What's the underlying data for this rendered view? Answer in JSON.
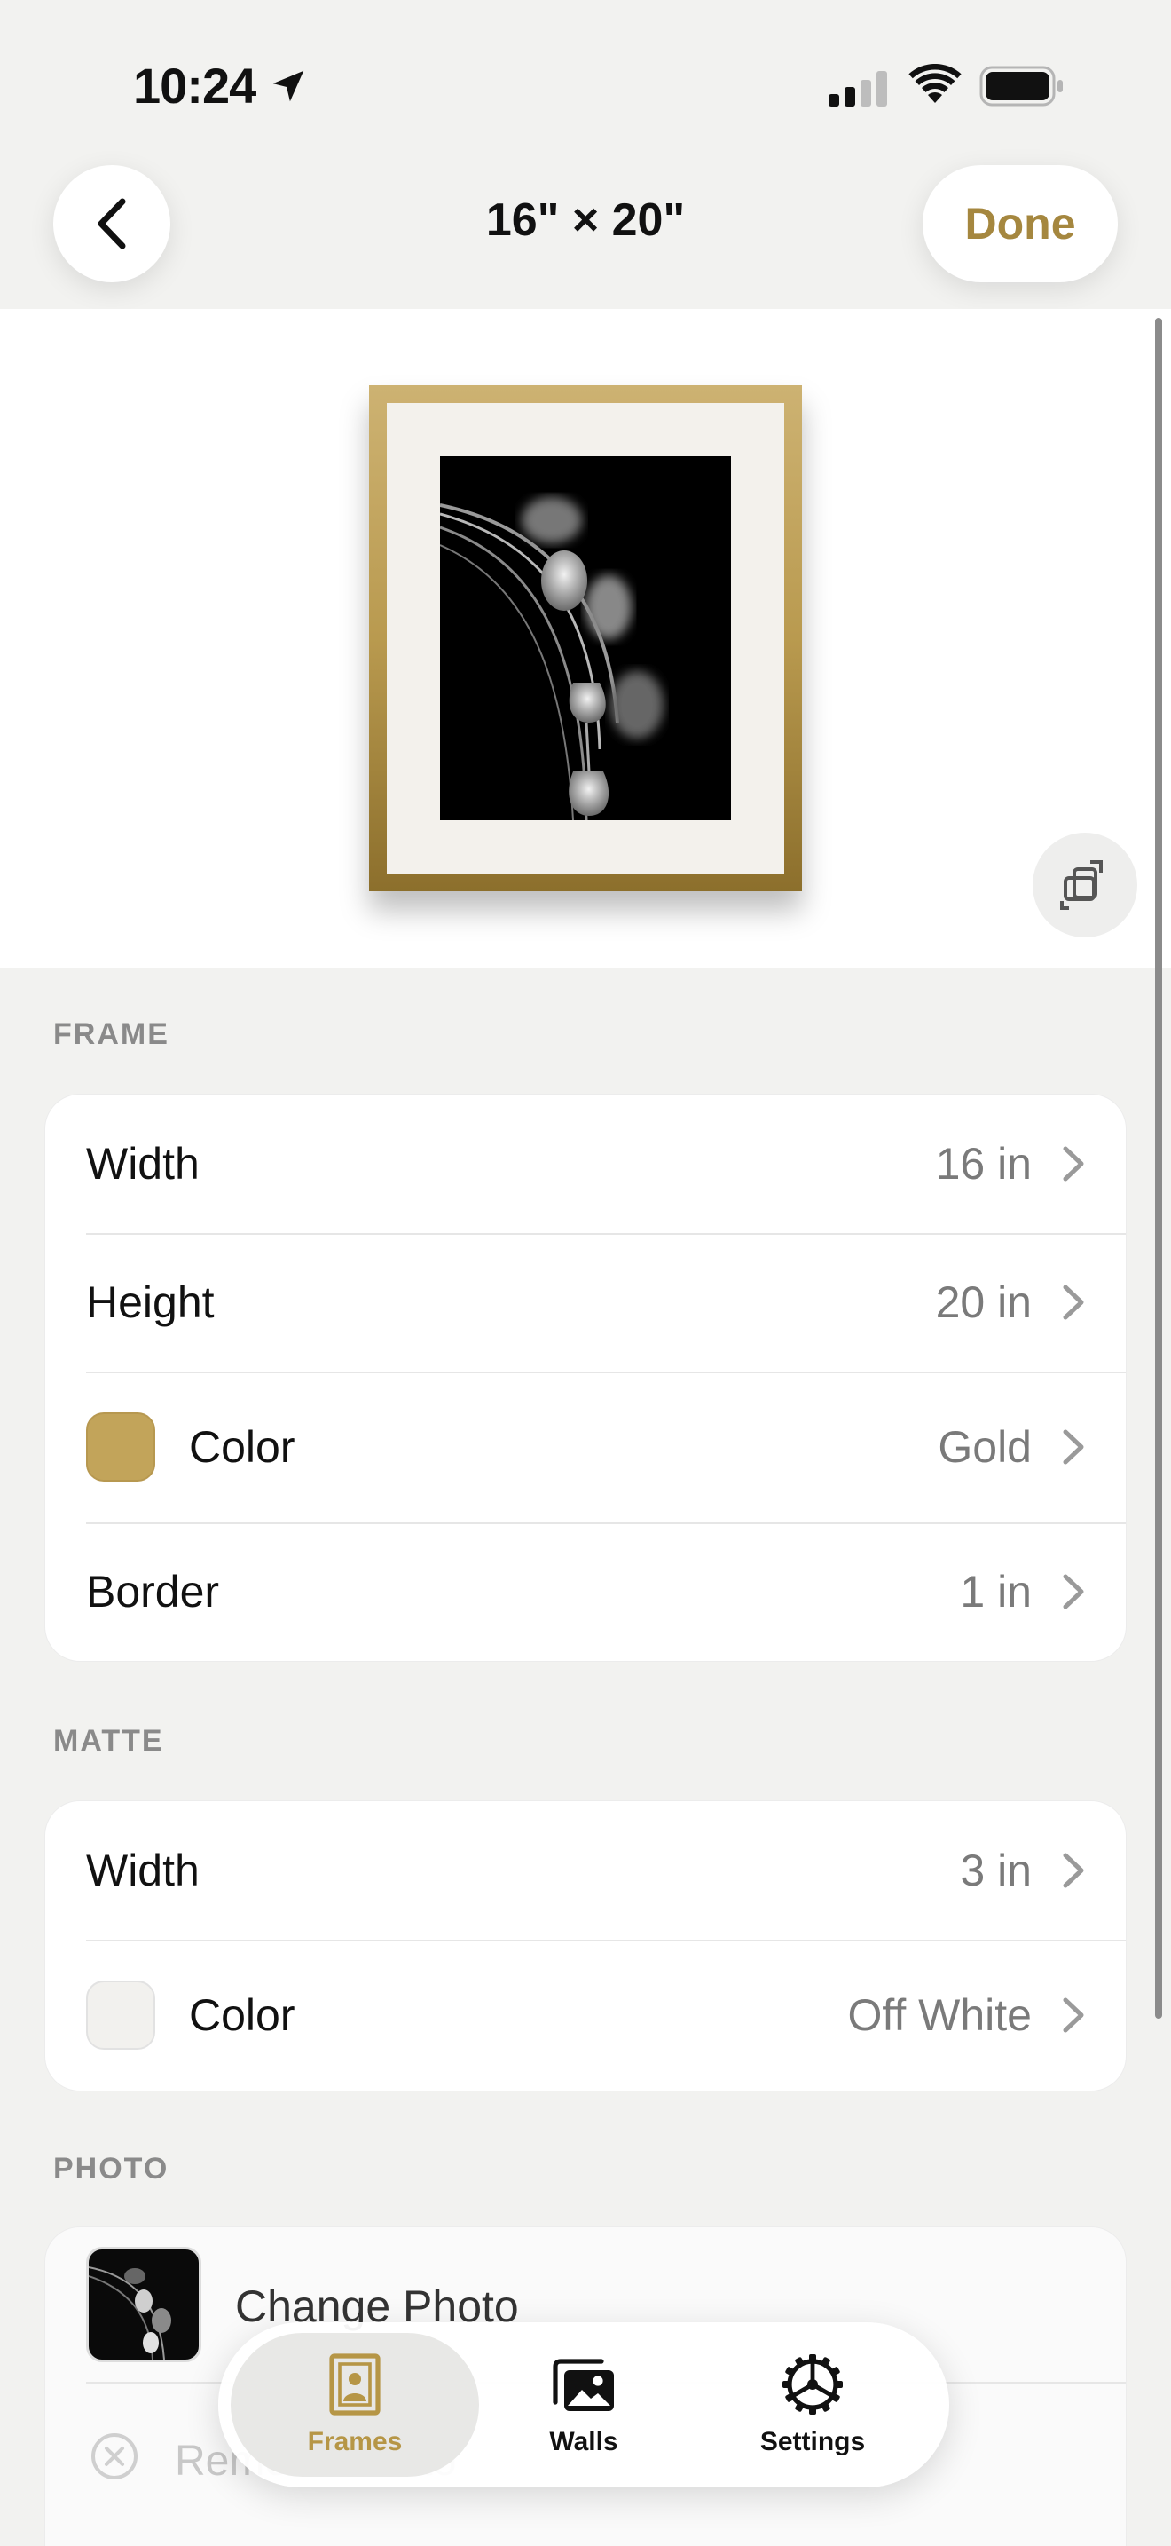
{
  "status_bar": {
    "time": "10:24",
    "icons": [
      "location-arrow-icon",
      "signal-icon",
      "wifi-icon",
      "battery-icon"
    ]
  },
  "nav": {
    "title": "16\" × 20\"",
    "done_label": "Done",
    "back_icon": "chevron-left-icon"
  },
  "colors": {
    "accent": "#a5873f",
    "frame_gold": "#c2a45a",
    "matte_off_white": "#f2f1ee"
  },
  "frame_section": {
    "header": "FRAME",
    "rows": [
      {
        "label": "Width",
        "value": "16 in"
      },
      {
        "label": "Height",
        "value": "20 in"
      },
      {
        "label": "Color",
        "value": "Gold"
      },
      {
        "label": "Border",
        "value": "1 in"
      }
    ]
  },
  "matte_section": {
    "header": "MATTE",
    "rows": [
      {
        "label": "Width",
        "value": "3 in"
      },
      {
        "label": "Color",
        "value": "Off White"
      }
    ]
  },
  "photo_section": {
    "header": "PHOTO",
    "change_label": "Change Photo",
    "remove_label": "Remove Photo"
  },
  "tabs": [
    {
      "label": "Frames",
      "icon": "frame-portrait-icon",
      "active": true
    },
    {
      "label": "Walls",
      "icon": "photos-stack-icon",
      "active": false
    },
    {
      "label": "Settings",
      "icon": "gear-icon",
      "active": false
    }
  ]
}
